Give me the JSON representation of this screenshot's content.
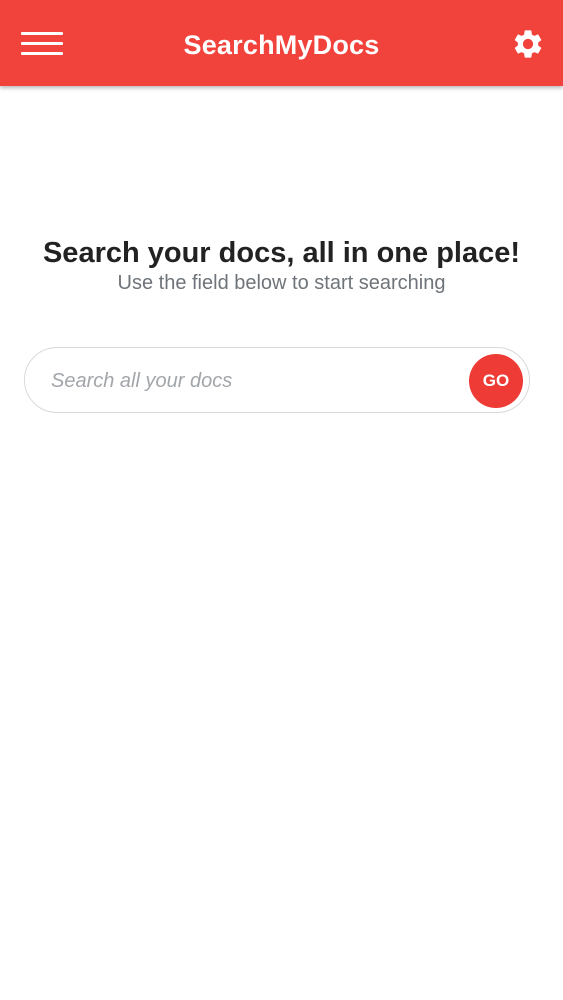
{
  "header": {
    "title": "SearchMyDocs",
    "menu_icon": "menu-icon",
    "settings_icon": "gear-icon",
    "color": "#f1423c"
  },
  "hero": {
    "title": "Search your docs, all in one place!",
    "subtitle": "Use the field below to start searching"
  },
  "search": {
    "value": "",
    "placeholder": "Search all your docs",
    "go_label": "GO",
    "go_color": "#ee3b35"
  }
}
